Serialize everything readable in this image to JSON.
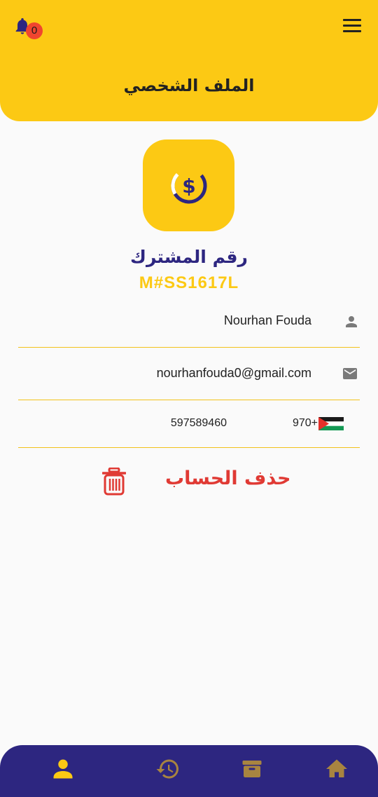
{
  "header": {
    "title": "الملف الشخصي",
    "notification_count": "0",
    "bell_icon": "bell-icon",
    "menu_icon": "hamburger-menu-icon"
  },
  "subscriber": {
    "label": "رقم المشترك",
    "id": "M#SS1617L",
    "logo_icon": "dollar-coin-icon"
  },
  "profile": {
    "name": "Nourhan Fouda",
    "email": "nourhanfouda0@gmail.com",
    "phone_code": "970+",
    "phone_number": "597589460"
  },
  "delete_account": {
    "label": "حذف الحساب",
    "icon": "trash-icon"
  },
  "bottom_nav": {
    "items": [
      "profile-icon",
      "history-icon",
      "box-icon",
      "home-icon"
    ],
    "active": "profile"
  },
  "colors": {
    "primary_yellow": "#fcc914",
    "primary_navy": "#2d2680",
    "danger": "#e03a34",
    "inactive_nav": "#a88440"
  }
}
